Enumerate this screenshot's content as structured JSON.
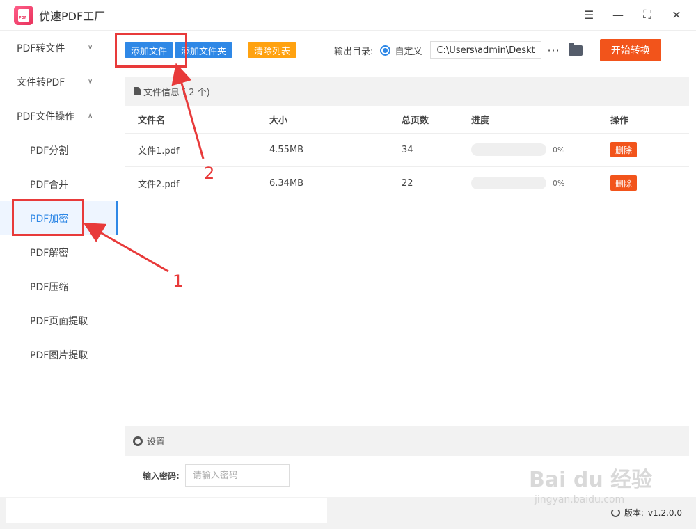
{
  "app": {
    "title": "优速PDF工厂",
    "logo_text": "PDF"
  },
  "window_controls": [
    "menu-icon",
    "minimize-icon",
    "maximize-icon",
    "close-icon"
  ],
  "sidebar": {
    "groups": [
      {
        "label": "PDF转文件",
        "expanded": false
      },
      {
        "label": "文件转PDF",
        "expanded": false
      },
      {
        "label": "PDF文件操作",
        "expanded": true
      }
    ],
    "items": [
      {
        "label": "PDF分割"
      },
      {
        "label": "PDF合并"
      },
      {
        "label": "PDF加密",
        "active": true
      },
      {
        "label": "PDF解密"
      },
      {
        "label": "PDF压缩"
      },
      {
        "label": "PDF页面提取"
      },
      {
        "label": "PDF图片提取"
      }
    ]
  },
  "toolbar": {
    "add_file": "添加文件",
    "add_folder": "添加文件夹",
    "clear_list": "清除列表",
    "output_label": "输出目录:",
    "custom_label": "自定义",
    "path_value": "C:\\Users\\admin\\Deskto",
    "more": "···",
    "start": "开始转换"
  },
  "file_panel": {
    "header": "文件信息",
    "count": "( 2 个)",
    "columns": [
      "文件名",
      "大小",
      "总页数",
      "进度",
      "操作"
    ],
    "rows": [
      {
        "name": "文件1.pdf",
        "size": "4.55MB",
        "pages": "34",
        "progress": 0,
        "progress_text": "0%",
        "action": "删除"
      },
      {
        "name": "文件2.pdf",
        "size": "6.34MB",
        "pages": "22",
        "progress": 0,
        "progress_text": "0%",
        "action": "删除"
      }
    ]
  },
  "settings": {
    "header": "设置",
    "password_label": "输入密码:",
    "password_placeholder": "请输入密码"
  },
  "status": {
    "version_label": "版本:",
    "version": "v1.2.0.0"
  },
  "annotations": {
    "one": "1",
    "two": "2",
    "color": "#e83a3a"
  },
  "watermark": {
    "main": "Bai du 经验",
    "sub": "jingyan.baidu.com"
  },
  "colors": {
    "primary": "#2f88e6",
    "orange": "#ffa210",
    "red": "#f2541b"
  }
}
